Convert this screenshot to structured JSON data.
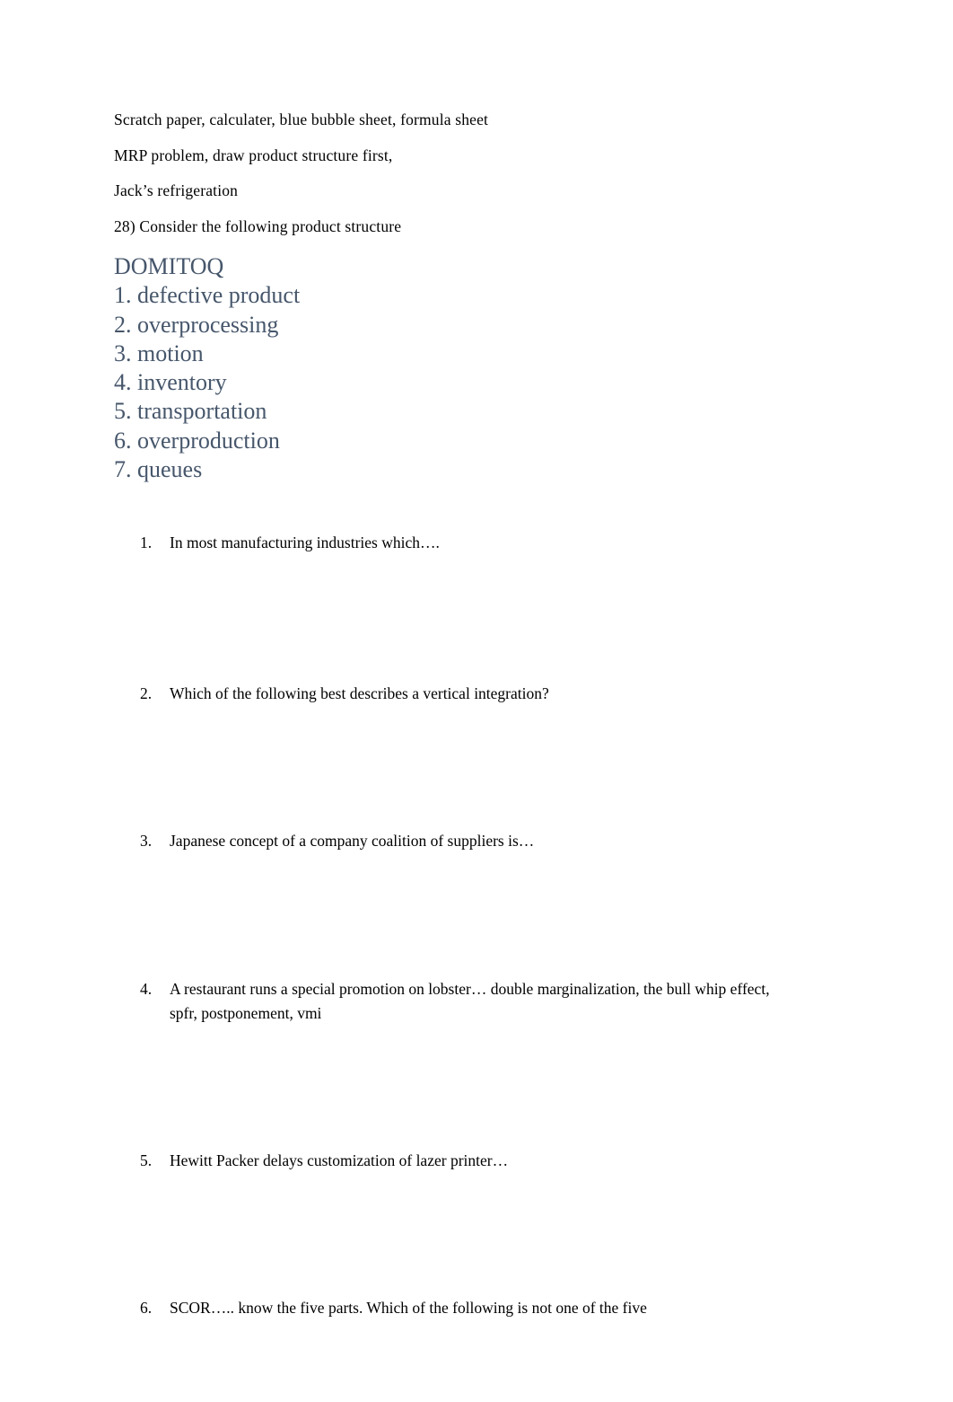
{
  "document": {
    "intro_lines": [
      "Scratch paper, calculater, blue bubble sheet, formula sheet",
      "MRP problem, draw product structure first,",
      "Jack’s refrigeration",
      "28) Consider the following product structure"
    ],
    "domitoq": {
      "heading": "DOMITOQ",
      "color": "#46566b",
      "items": [
        "1. defective product",
        "2. overprocessing",
        "3. motion",
        "4. inventory",
        "5. transportation",
        "6. overproduction",
        "7. queues"
      ]
    },
    "questions": [
      {
        "number": "1.",
        "line1": "In most manufacturing industries which….",
        "line2": ""
      },
      {
        "number": "2.",
        "line1": "Which of the following best describes a vertical integration?",
        "line2": ""
      },
      {
        "number": "3.",
        "line1": "Japanese concept of a company coalition of suppliers is…",
        "line2": ""
      },
      {
        "number": "4.",
        "line1": "A restaurant runs a special promotion on lobster… double marginalization, the bull whip effect,",
        "line2": "spfr, postponement, vmi"
      },
      {
        "number": "5.",
        "line1": "Hewitt Packer delays customization of lazer printer…",
        "line2": ""
      },
      {
        "number": "6.",
        "line1": "SCOR….. know the five parts. Which of the following is not one of the five",
        "line2": ""
      }
    ]
  }
}
